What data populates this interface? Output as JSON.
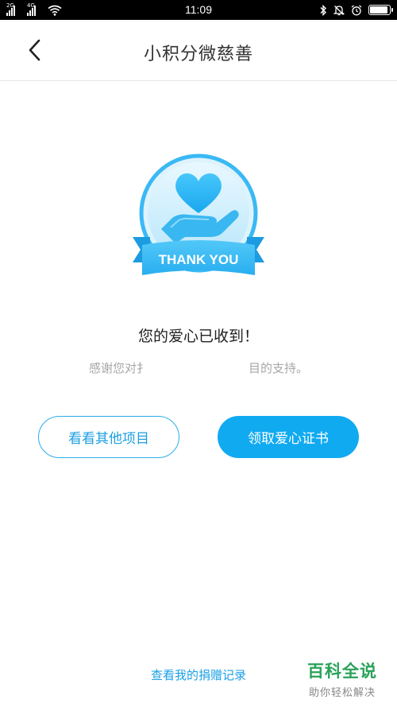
{
  "status_bar": {
    "signal1_label": "2G",
    "signal2_label": "4G",
    "time": "11:09",
    "icons": [
      "bluetooth-icon",
      "bell-off-icon",
      "alarm-icon",
      "battery-icon"
    ],
    "battery_level": 0.9
  },
  "navbar": {
    "back_icon": "chevron-left-icon",
    "title": "小积分微慈善"
  },
  "badge": {
    "ribbon_text": "THANK YOU",
    "icon": "heart-in-hand-icon",
    "color": "#31b9f3"
  },
  "message": {
    "title": "您的爱心已收到！",
    "subtitle_left": "感谢您对扌",
    "subtitle_right": "目的支持。"
  },
  "buttons": {
    "more_projects": "看看其他项目",
    "get_certificate": "领取爱心证书"
  },
  "footer": {
    "donation_record_link": "查看我的捐赠记录"
  },
  "watermark": {
    "main": "百科全说",
    "sub": "助你轻松解决"
  },
  "colors": {
    "accent": "#10aaf1",
    "outline": "#2aaee8",
    "watermark_green": "#2aa25a"
  }
}
